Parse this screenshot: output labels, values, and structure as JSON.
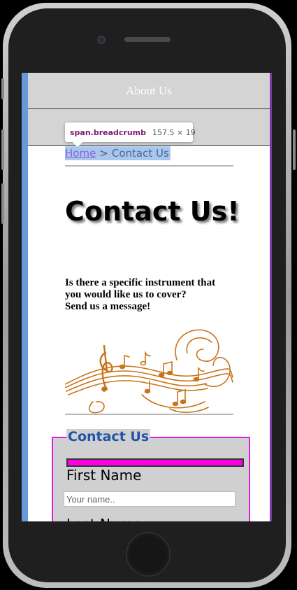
{
  "nav": {
    "about_label": "About Us"
  },
  "devtools_tooltip": {
    "selector": "span.breadcrumb",
    "size": "157.5 × 19"
  },
  "breadcrumb": {
    "home": "Home",
    "separator": ">",
    "current": "Contact Us"
  },
  "page": {
    "title": "Contact Us!",
    "intro_line1": "Is there a specific instrument that",
    "intro_line2": "you would like us to cover?",
    "intro_line3": "Send us a message!",
    "music_art_icon": "music-notes-illustration-icon"
  },
  "form": {
    "legend": "Contact Us",
    "progress_fraction": 1.0,
    "first_name_label": "First Name",
    "first_name_placeholder": "Your name..",
    "last_name_label": "Last Name"
  },
  "colors": {
    "nav_bg": "#d4d4d4",
    "legend_text": "#1f55a8",
    "fieldset_border": "#e020e0",
    "progress_fill": "#ff00e6",
    "breadcrumb_highlight": "#a9c7ee",
    "music_art": "#c8741a"
  }
}
